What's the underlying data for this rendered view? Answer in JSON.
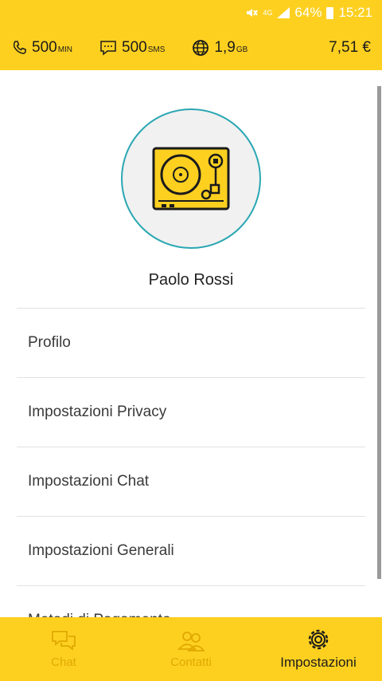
{
  "status_bar": {
    "network": "4G",
    "battery": "64%",
    "time": "15:21"
  },
  "credit_bar": {
    "minutes_value": "500",
    "minutes_unit": "MIN",
    "sms_value": "500",
    "sms_unit": "SMS",
    "data_value": "1,9",
    "data_unit": "GB",
    "balance": "7,51 €"
  },
  "profile": {
    "name": "Paolo Rossi"
  },
  "menu": {
    "items": [
      {
        "label": "Profilo"
      },
      {
        "label": "Impostazioni Privacy"
      },
      {
        "label": "Impostazioni Chat"
      },
      {
        "label": "Impostazioni Generali"
      },
      {
        "label": "Metodi di Pagamento"
      }
    ]
  },
  "bottom_nav": {
    "tabs": [
      {
        "label": "Chat",
        "icon": "chat-icon"
      },
      {
        "label": "Contatti",
        "icon": "contacts-icon"
      },
      {
        "label": "Impostazioni",
        "icon": "gear-icon"
      }
    ],
    "active_tab": "Impostazioni"
  },
  "colors": {
    "brand_yellow": "#fdd020",
    "avatar_ring": "#2aa7b3",
    "inactive_tab": "#e0a800"
  }
}
